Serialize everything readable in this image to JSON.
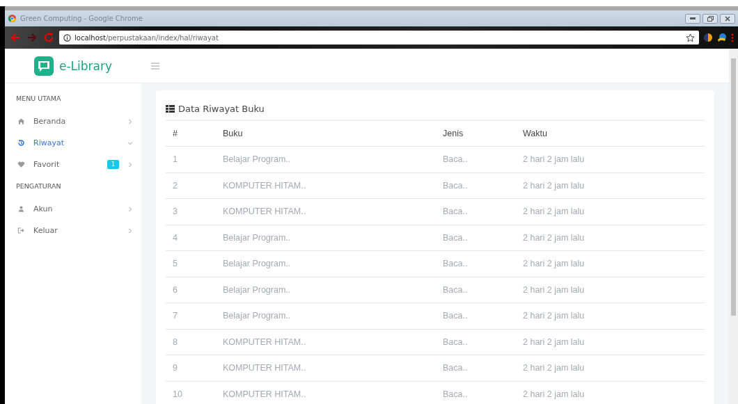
{
  "window": {
    "title": "Green Computing - Google Chrome"
  },
  "browser": {
    "url_host": "localhost",
    "url_path": "/perpustakaan/index/hal/riwayat"
  },
  "app": {
    "logo": "e-Library"
  },
  "sidebar": {
    "sections": [
      {
        "heading": "MENU UTAMA",
        "items": [
          {
            "label": "Beranda",
            "kind": "home",
            "selected": false,
            "expanded": false
          },
          {
            "label": "Riwayat",
            "kind": "history",
            "selected": true,
            "expanded": true
          },
          {
            "label": "Favorit",
            "kind": "heart",
            "selected": false,
            "expanded": false,
            "badge": "1"
          }
        ]
      },
      {
        "heading": "PENGATURAN",
        "items": [
          {
            "label": "Akun",
            "kind": "user",
            "selected": false,
            "expanded": false
          },
          {
            "label": "Keluar",
            "kind": "logout",
            "selected": false,
            "expanded": false
          }
        ]
      }
    ]
  },
  "card": {
    "title": "Data Riwayat Buku"
  },
  "table": {
    "columns": [
      "#",
      "Buku",
      "Jenis",
      "Waktu"
    ],
    "rows": [
      [
        "1",
        "Belajar Program..",
        "Baca..",
        "2 hari 2 jam lalu"
      ],
      [
        "2",
        "KOMPUTER HITAM..",
        "Baca..",
        "2 hari 2 jam lalu"
      ],
      [
        "3",
        "KOMPUTER HITAM..",
        "Baca..",
        "2 hari 2 jam lalu"
      ],
      [
        "4",
        "Belajar Program..",
        "Baca..",
        "2 hari 2 jam lalu"
      ],
      [
        "5",
        "Belajar Program..",
        "Baca..",
        "2 hari 2 jam lalu"
      ],
      [
        "6",
        "Belajar Program..",
        "Baca..",
        "2 hari 2 jam lalu"
      ],
      [
        "7",
        "Belajar Program..",
        "Baca..",
        "2 hari 2 jam lalu"
      ],
      [
        "8",
        "KOMPUTER HITAM..",
        "Baca..",
        "2 hari 2 jam lalu"
      ],
      [
        "9",
        "KOMPUTER HITAM..",
        "Baca..",
        "2 hari 2 jam lalu"
      ],
      [
        "10",
        "KOMPUTER HITAM..",
        "Baca..",
        "2 hari 2 jam lalu"
      ]
    ]
  }
}
